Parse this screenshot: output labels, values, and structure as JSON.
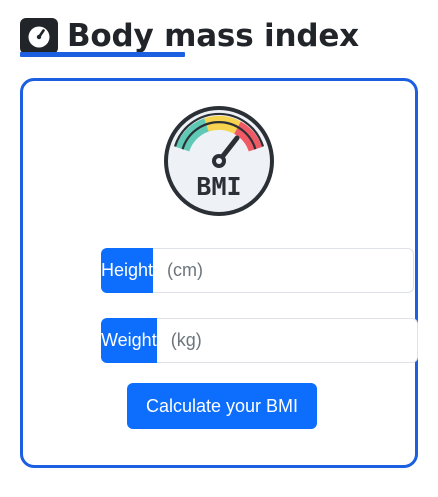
{
  "header": {
    "title": "Body mass index",
    "icon": "scale-icon"
  },
  "card": {
    "gauge_icon": "bmi-gauge-icon",
    "gauge_label": "BMI",
    "height": {
      "label": "Height",
      "value": "",
      "placeholder": "(cm)"
    },
    "weight": {
      "label": "Weight",
      "value": "",
      "placeholder": "(kg)"
    },
    "calculate_label": "Calculate your BMI"
  },
  "colors": {
    "accent": "#1c5fe0",
    "button": "#0d6efd",
    "text": "#212529",
    "gauge_green": "#5fc9b6",
    "gauge_yellow": "#f6d44f",
    "gauge_red": "#ef5a64"
  }
}
